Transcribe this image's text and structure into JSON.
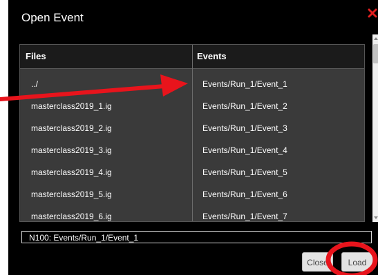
{
  "dialog": {
    "title": "Open Event"
  },
  "table": {
    "headers": {
      "files": "Files",
      "events": "Events"
    },
    "rows": [
      {
        "file": "../",
        "event": "Events/Run_1/Event_1"
      },
      {
        "file": "masterclass2019_1.ig",
        "event": "Events/Run_1/Event_2"
      },
      {
        "file": "masterclass2019_2.ig",
        "event": "Events/Run_1/Event_3"
      },
      {
        "file": "masterclass2019_3.ig",
        "event": "Events/Run_1/Event_4"
      },
      {
        "file": "masterclass2019_4.ig",
        "event": "Events/Run_1/Event_5"
      },
      {
        "file": "masterclass2019_5.ig",
        "event": "Events/Run_1/Event_6"
      },
      {
        "file": "masterclass2019_6.ig",
        "event": "Events/Run_1/Event_7"
      }
    ]
  },
  "selected": {
    "value": "N100: Events/Run_1/Event_1"
  },
  "buttons": {
    "close": "Close",
    "load": "Load"
  },
  "colors": {
    "dialog_bg": "#000000",
    "table_bg": "#3a3a3a",
    "header_bg": "#1b1b1b",
    "close_icon": "#e02020",
    "annotation": "#e8141c"
  },
  "icons": {
    "close": "close-x-icon",
    "annotation_arrow": "arrow-right-icon",
    "annotation_circle": "highlight-circle"
  }
}
